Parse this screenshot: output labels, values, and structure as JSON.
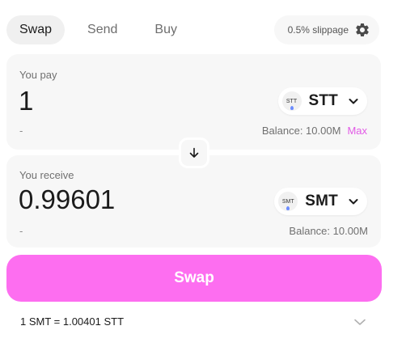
{
  "tabs": [
    {
      "label": "Swap",
      "active": true
    },
    {
      "label": "Send",
      "active": false
    },
    {
      "label": "Buy",
      "active": false
    }
  ],
  "slippage": {
    "label": "0.5% slippage",
    "icon": "gear-icon"
  },
  "pay": {
    "label": "You pay",
    "amount": "1",
    "fiat": "-",
    "token": {
      "symbol": "STT",
      "logo_text": "STT"
    },
    "balance": "Balance: 10.00M",
    "max_label": "Max"
  },
  "receive": {
    "label": "You receive",
    "amount": "0.99601",
    "fiat": "-",
    "token": {
      "symbol": "SMT",
      "logo_text": "SMT"
    },
    "balance": "Balance: 10.00M"
  },
  "switch_icon": "arrow-down-icon",
  "swap_button": {
    "label": "Swap"
  },
  "rate": {
    "text": "1 SMT = 1.00401 STT"
  },
  "colors": {
    "accent": "#fd6ef0",
    "max_text": "#e25ae6",
    "panel_bg": "#f7f7f7",
    "active_tab_bg": "#f0f0f0"
  }
}
